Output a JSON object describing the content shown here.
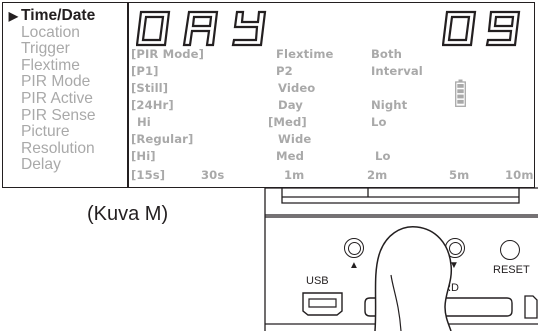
{
  "menu": {
    "items": [
      {
        "label": "Time/Date",
        "active": true
      },
      {
        "label": "Location",
        "active": false
      },
      {
        "label": "Trigger",
        "active": false
      },
      {
        "label": "Flextime",
        "active": false
      },
      {
        "label": "PIR Mode",
        "active": false
      },
      {
        "label": "PIR Active",
        "active": false
      },
      {
        "label": "PIR Sense",
        "active": false
      },
      {
        "label": "Picture",
        "active": false
      },
      {
        "label": "Resolution",
        "active": false
      },
      {
        "label": "Delay",
        "active": false
      }
    ],
    "arrow_glyph": "▶"
  },
  "display": {
    "main_text": "DAY",
    "value_text": "09"
  },
  "options": [
    [
      "[PIR Mode]",
      "Flextime",
      "Both"
    ],
    [
      "[P1]",
      "P2",
      "Interval"
    ],
    [
      "[Still]",
      "Video"
    ],
    [
      "[24Hr]",
      "Day",
      "Night"
    ],
    [
      "Hi",
      "[Med]",
      "Lo"
    ],
    [
      "[Regular]",
      "Wide"
    ],
    [
      "[Hi]",
      "Med",
      "Lo"
    ],
    [
      "[15s]",
      "30s",
      "1m",
      "2m",
      "5m",
      "10m"
    ]
  ],
  "caption": "(Kuva M)",
  "device": {
    "usb_label": "USB",
    "sd_label": "RD",
    "reset_label": "RESET",
    "up_glyph": "▲",
    "down_glyph": "▼"
  },
  "colors": {
    "ink": "#231f20",
    "inactive": "#a9a9a9"
  }
}
